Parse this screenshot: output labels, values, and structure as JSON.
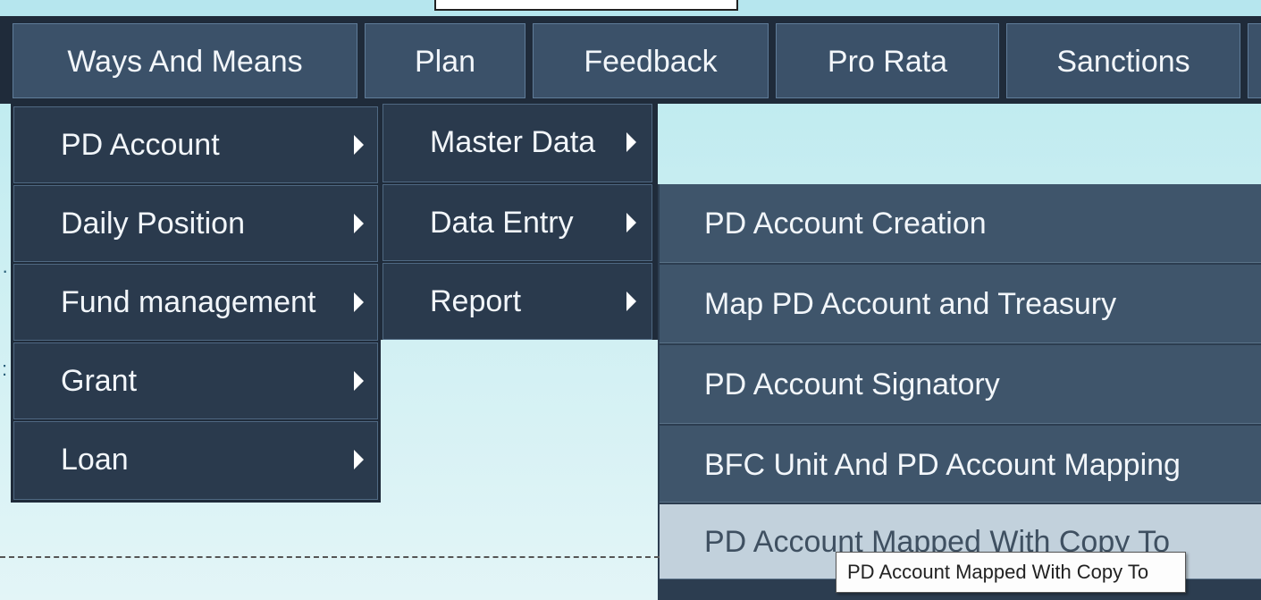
{
  "menubar": {
    "items": [
      {
        "label": "Ways And Means"
      },
      {
        "label": "Plan"
      },
      {
        "label": "Feedback"
      },
      {
        "label": "Pro Rata"
      },
      {
        "label": "Sanctions"
      }
    ]
  },
  "level1": {
    "items": [
      {
        "label": "PD Account"
      },
      {
        "label": "Daily Position"
      },
      {
        "label": "Fund management"
      },
      {
        "label": "Grant"
      },
      {
        "label": "Loan"
      }
    ]
  },
  "level2": {
    "items": [
      {
        "label": "Master Data"
      },
      {
        "label": "Data Entry"
      },
      {
        "label": "Report"
      }
    ]
  },
  "level3": {
    "items": [
      {
        "label": "PD Account Creation"
      },
      {
        "label": "Map PD Account and Treasury"
      },
      {
        "label": "PD Account Signatory"
      },
      {
        "label": "BFC Unit And PD Account Mapping"
      },
      {
        "label": "PD Account Mapped With Copy To"
      }
    ],
    "hovered_index": 4
  },
  "tooltip": {
    "text": "PD Account Mapped With Copy To"
  },
  "colors": {
    "menubar_bg": "#1f2b3a",
    "top_item_bg": "#3b5169",
    "menu_item_bg": "#2a3a4d",
    "submenu_bg": "#3f556b",
    "hover_bg": "#c2d1dc",
    "page_bg": "#c5ecf1"
  }
}
